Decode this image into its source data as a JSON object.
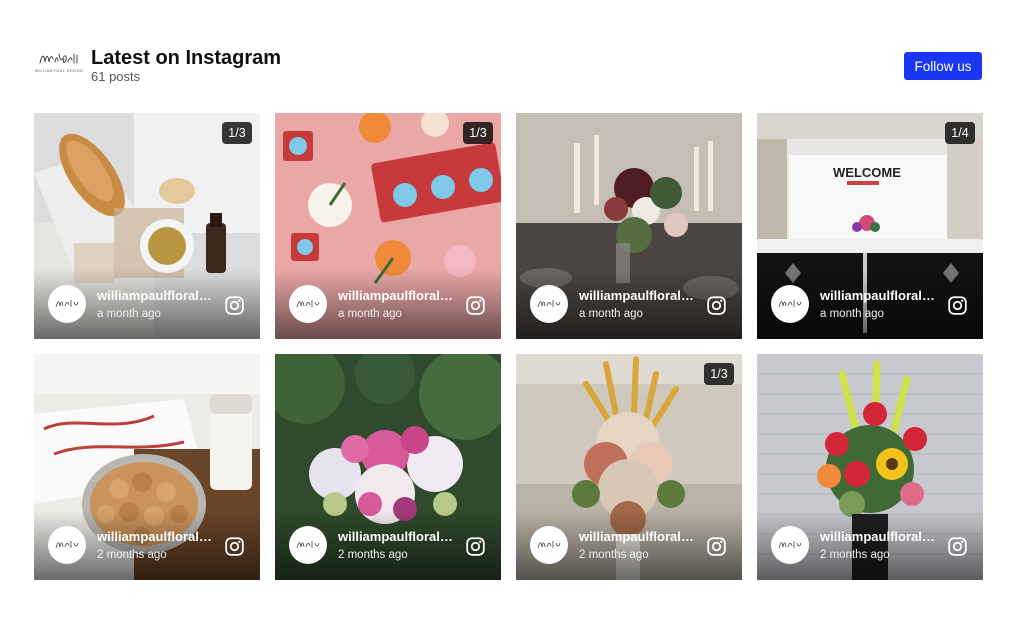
{
  "header": {
    "logo_alt": "William Paul Floral Design",
    "title": "Latest on Instagram",
    "post_count": "61 posts",
    "follow_label": "Follow us"
  },
  "colors": {
    "accent": "#1a36f2"
  },
  "posts": [
    {
      "username": "williampaulfloraldesign",
      "time": "a month ago",
      "badge": "1/3",
      "icon": "instagram-icon"
    },
    {
      "username": "williampaulfloraldesign",
      "time": "a month ago",
      "badge": "1/3",
      "icon": "instagram-icon"
    },
    {
      "username": "williampaulfloraldesign",
      "time": "a month ago",
      "badge": "",
      "icon": "instagram-icon"
    },
    {
      "username": "williampaulfloraldesign",
      "time": "a month ago",
      "badge": "1/4",
      "icon": "instagram-icon"
    },
    {
      "username": "williampaulfloraldesign",
      "time": "2 months ago",
      "badge": "",
      "icon": "instagram-icon"
    },
    {
      "username": "williampaulfloraldesign",
      "time": "2 months ago",
      "badge": "",
      "icon": "instagram-icon"
    },
    {
      "username": "williampaulfloraldesign",
      "time": "2 months ago",
      "badge": "1/3",
      "icon": "instagram-icon"
    },
    {
      "username": "williampaulfloraldesign",
      "time": "2 months ago",
      "badge": "",
      "icon": "instagram-icon"
    }
  ],
  "photo_text": {
    "welcome_sign": "WELCOME"
  }
}
